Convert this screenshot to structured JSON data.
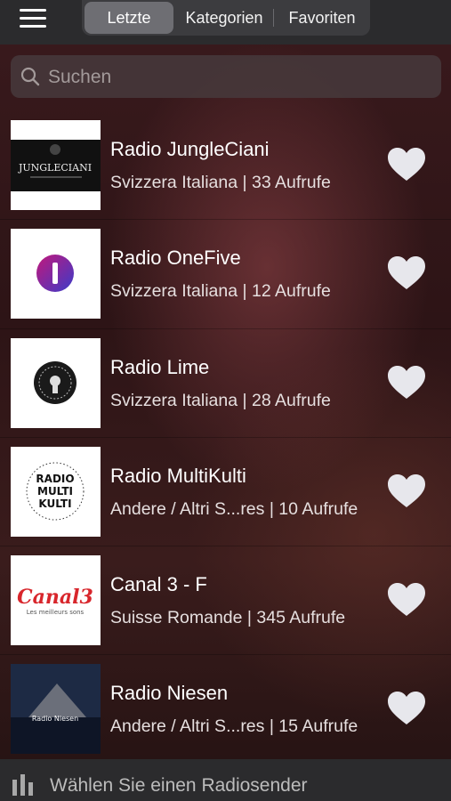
{
  "header": {
    "tabs": [
      {
        "label": "Letzte",
        "active": true
      },
      {
        "label": "Kategorien",
        "active": false
      },
      {
        "label": "Favoriten",
        "active": false
      }
    ]
  },
  "search": {
    "placeholder": "Suchen",
    "value": ""
  },
  "stations": [
    {
      "title": "Radio JungleCiani",
      "subtitle": "Svizzera Italiana | 33  Aufrufe",
      "logo": "jungleciani-logo"
    },
    {
      "title": "Radio OneFive",
      "subtitle": "Svizzera Italiana | 12  Aufrufe",
      "logo": "onefive-logo"
    },
    {
      "title": "Radio Lime",
      "subtitle": "Svizzera Italiana | 28  Aufrufe",
      "logo": "radio-lime-logo"
    },
    {
      "title": "Radio MultiKulti",
      "subtitle": "Andere / Altri S...res | 10  Aufrufe",
      "logo": "multikulti-logo"
    },
    {
      "title": "Canal 3 - F",
      "subtitle": "Suisse Romande | 345  Aufrufe",
      "logo": "canal3-logo"
    },
    {
      "title": "Radio Niesen",
      "subtitle": "Andere / Altri S...res | 15  Aufrufe",
      "logo": "niesen-logo"
    }
  ],
  "logo_text": {
    "jungleciani": "JUNGLECIANI",
    "multikulti": [
      "RADIO",
      "MULTI",
      "KULTI"
    ],
    "canal3": "Canal3",
    "canal3_tag": "Les meilleurs sons",
    "niesen": "Radio Niesen"
  },
  "player": {
    "label": "Wählen Sie einen Radiosender",
    "icon": "equalizer-icon"
  },
  "colors": {
    "accent_tab": "#6e6e73",
    "heart": "#e7e7ec",
    "bar": "#2b2b2d"
  }
}
